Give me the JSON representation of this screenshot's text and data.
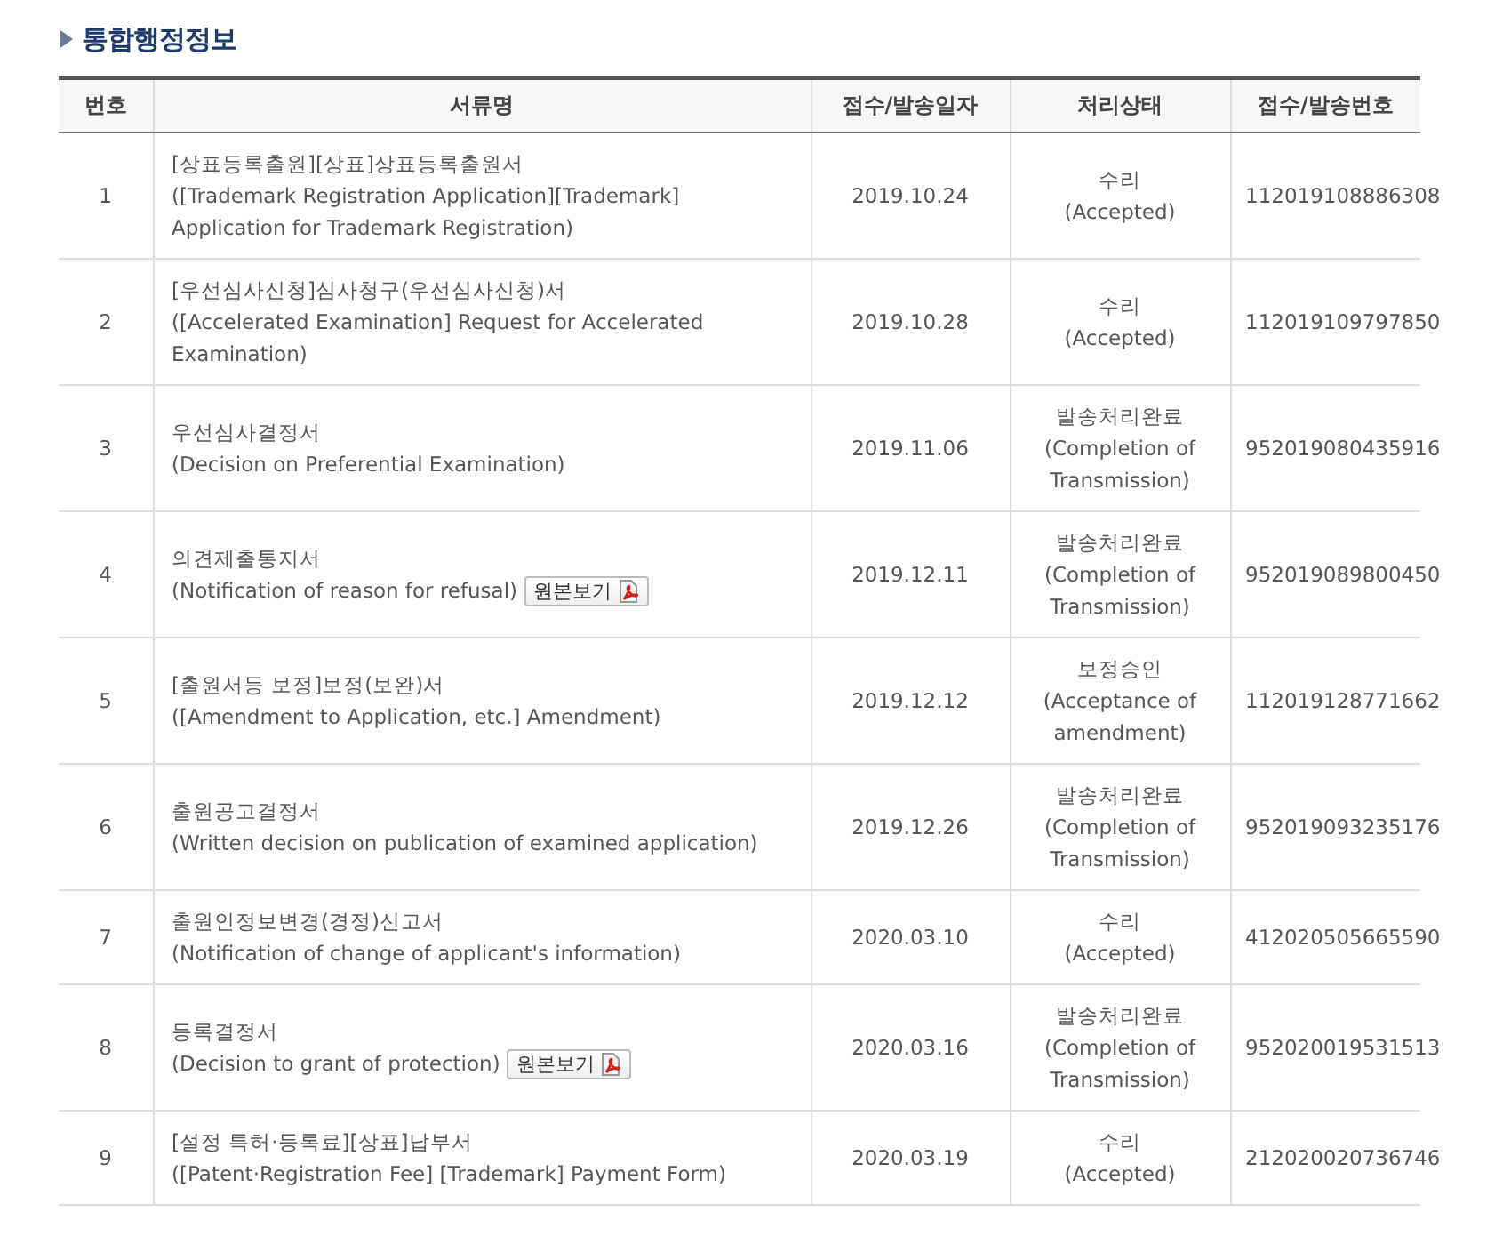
{
  "title": "통합행정정보",
  "table": {
    "columns": [
      "번호",
      "서류명",
      "접수/발송일자",
      "처리상태",
      "접수/발송번호"
    ],
    "rows": [
      {
        "number": "1",
        "title": "[상표등록출원][상표]상표등록출원서",
        "description": "([Trademark Registration Application][Trademark] Application for Trademark Registration)",
        "date": "2019.10.24",
        "status": "수리",
        "status_en": "(Accepted)",
        "doc_number": "112019108886308"
      },
      {
        "number": "2",
        "title": "[우선심사신청]심사청구(우선심사신청)서",
        "description": "([Accelerated Examination] Request for Accelerated Examination)",
        "date": "2019.10.28",
        "status": "수리",
        "status_en": "(Accepted)",
        "doc_number": "112019109797850"
      },
      {
        "number": "3",
        "title": "우선심사결정서",
        "description": "(Decision on Preferential Examination)",
        "date": "2019.11.06",
        "status": "발송처리완료",
        "status_en": "(Completion of Transmission)",
        "doc_number": "952019080435916"
      },
      {
        "number": "4",
        "title": "의견제출통지서",
        "description": "(Notification of reason for refusal)",
        "view_button": "원본보기",
        "date": "2019.12.11",
        "status": "발송처리완료",
        "status_en": "(Completion of Transmission)",
        "doc_number": "952019089800450"
      },
      {
        "number": "5",
        "title": "[출원서등 보정]보정(보완)서",
        "description": "([Amendment to Application, etc.] Amendment)",
        "date": "2019.12.12",
        "status": "보정승인",
        "status_en": "(Acceptance of amendment)",
        "doc_number": "112019128771662"
      },
      {
        "number": "6",
        "title": "출원공고결정서",
        "description": "(Written decision on publication of examined application)",
        "date": "2019.12.26",
        "status": "발송처리완료",
        "status_en": "(Completion of Transmission)",
        "doc_number": "952019093235176"
      },
      {
        "number": "7",
        "title": "출원인정보변경(경정)신고서",
        "description": "(Notification of change of applicant's information)",
        "date": "2020.03.10",
        "status": "수리",
        "status_en": "(Accepted)",
        "doc_number": "412020505665590"
      },
      {
        "number": "8",
        "title": "등록결정서",
        "description": "(Decision to grant of protection)",
        "view_button": "원본보기",
        "date": "2020.03.16",
        "status": "발송처리완료",
        "status_en": "(Completion of Transmission)",
        "doc_number": "952020019531513"
      },
      {
        "number": "9",
        "title": "[설정 특허·등록료][상표]납부서",
        "description": "([Patent·Registration Fee] [Trademark] Payment Form)",
        "date": "2020.03.19",
        "status": "수리",
        "status_en": "(Accepted)",
        "doc_number": "212020020736746"
      }
    ]
  }
}
